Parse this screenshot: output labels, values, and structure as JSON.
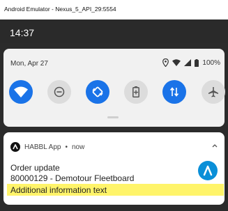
{
  "window": {
    "title": "Android Emulator - Nexus_5_API_29:5554"
  },
  "statusbar": {
    "time": "14:37"
  },
  "quick_settings": {
    "date": "Mon, Apr 27",
    "battery_percent": "100%",
    "status_icons": [
      "location-icon",
      "wifi-signal-icon",
      "cellular-signal-icon",
      "battery-icon"
    ],
    "tiles": [
      {
        "name": "wifi",
        "icon": "wifi-icon",
        "active": true
      },
      {
        "name": "do-not-disturb",
        "icon": "do-not-disturb-icon",
        "active": false
      },
      {
        "name": "auto-rotate",
        "icon": "auto-rotate-icon",
        "active": true
      },
      {
        "name": "battery-saver",
        "icon": "battery-saver-icon",
        "active": false
      },
      {
        "name": "mobile-data",
        "icon": "mobile-data-icon",
        "active": true
      },
      {
        "name": "airplane-mode",
        "icon": "airplane-icon",
        "active": false
      }
    ]
  },
  "notification": {
    "app_name": "HABBL App",
    "separator": "•",
    "time": "now",
    "title": "Order update",
    "text": "80000129 - Demotour Fleetboard",
    "extra": "Additional information text",
    "expand_icon": "chevron-up-icon",
    "highlight_color": "#fff46a"
  },
  "colors": {
    "accent": "#1a73e8",
    "tile_off": "#dcdcdc",
    "notification_icon": "#0a8fd8"
  }
}
